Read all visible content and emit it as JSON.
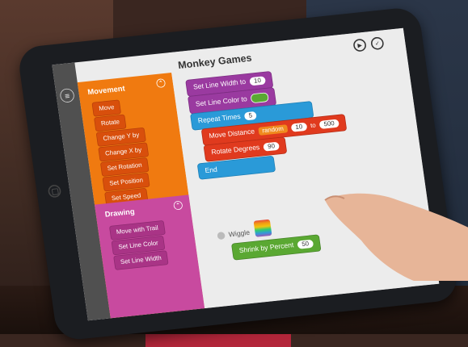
{
  "app": {
    "title": "Monkey Games"
  },
  "toolbar": {
    "play_icon": "play-icon",
    "done_icon": "check-icon"
  },
  "palette": {
    "movement": {
      "title": "Movement",
      "items": [
        "Move",
        "Rotate",
        "Change Y by",
        "Change X by",
        "Set Rotation",
        "Set Position",
        "Set Speed"
      ]
    },
    "drawing": {
      "title": "Drawing",
      "items": [
        "Move with Trail",
        "Set Line Color",
        "Set Line Width"
      ]
    }
  },
  "script": {
    "set_line_width": {
      "label": "Set Line Width to",
      "value": "10"
    },
    "set_line_color": {
      "label": "Set Line Color to",
      "color": "#5aa832"
    },
    "repeat": {
      "label": "Repeat Times",
      "value": "5"
    },
    "move_distance": {
      "label": "Move Distance",
      "mode": "random",
      "min": "10",
      "to": "to",
      "max": "500"
    },
    "rotate_degrees": {
      "label": "Rotate Degrees",
      "value": "90"
    },
    "end": {
      "label": "End"
    },
    "wiggle": {
      "label": "Wiggle"
    },
    "shrink": {
      "label": "Shrink by Percent",
      "value": "50"
    }
  },
  "colors": {
    "movement": "#f07a10",
    "drawing": "#c84a9f",
    "block_purple": "#9a3aa0",
    "block_blue": "#2a9ad8",
    "block_red": "#e03a1e",
    "block_green": "#5aa832"
  }
}
